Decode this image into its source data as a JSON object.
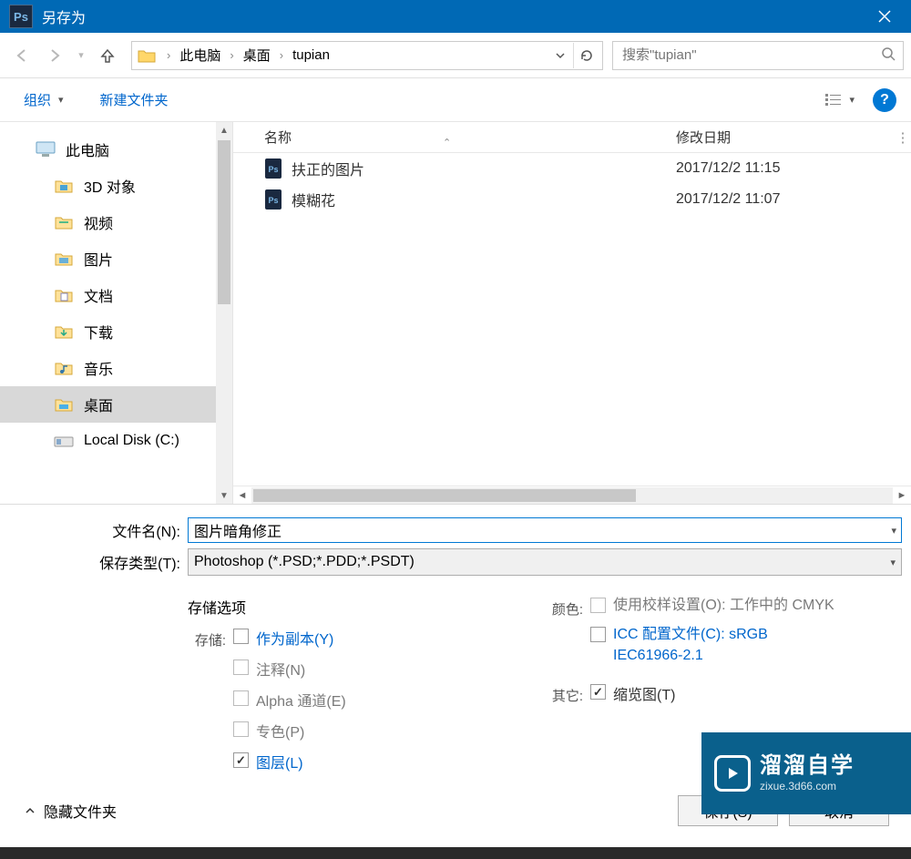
{
  "window": {
    "title": "另存为"
  },
  "breadcrumb": {
    "items": [
      "此电脑",
      "桌面",
      "tupian"
    ]
  },
  "search": {
    "placeholder": "搜索\"tupian\""
  },
  "toolbar": {
    "organize": "组织",
    "newFolder": "新建文件夹"
  },
  "sidebar": {
    "items": [
      {
        "label": "此电脑",
        "indent": false,
        "icon": "pc"
      },
      {
        "label": "3D 对象",
        "indent": true,
        "icon": "3d"
      },
      {
        "label": "视频",
        "indent": true,
        "icon": "video"
      },
      {
        "label": "图片",
        "indent": true,
        "icon": "pics"
      },
      {
        "label": "文档",
        "indent": true,
        "icon": "docs"
      },
      {
        "label": "下载",
        "indent": true,
        "icon": "dl"
      },
      {
        "label": "音乐",
        "indent": true,
        "icon": "music"
      },
      {
        "label": "桌面",
        "indent": true,
        "icon": "desk",
        "selected": true
      },
      {
        "label": "Local Disk (C:)",
        "indent": true,
        "icon": "disk"
      }
    ]
  },
  "filelist": {
    "columns": {
      "name": "名称",
      "modified": "修改日期"
    },
    "rows": [
      {
        "name": "扶正的图片",
        "modified": "2017/12/2 11:15"
      },
      {
        "name": "模糊花",
        "modified": "2017/12/2 11:07"
      }
    ]
  },
  "form": {
    "filenameLabel": "文件名(N):",
    "filenameValue": "图片暗角修正",
    "typeLabel": "保存类型(T):",
    "typeValue": "Photoshop (*.PSD;*.PDD;*.PSDT)"
  },
  "storage": {
    "title": "存储选项",
    "label": "存储:",
    "options": {
      "asCopy": "作为副本(Y)",
      "notes": "注释(N)",
      "alpha": "Alpha 通道(E)",
      "spot": "专色(P)",
      "layers": "图层(L)"
    }
  },
  "color": {
    "label": "颜色:",
    "proof": "使用校样设置(O):  工作中的 CMYK",
    "icc": "ICC 配置文件(C): sRGB IEC61966-2.1"
  },
  "other": {
    "label": "其它:",
    "thumb": "缩览图(T)"
  },
  "footer": {
    "hideFolders": "隐藏文件夹",
    "save": "保存(S)",
    "cancel": "取消"
  },
  "watermark": {
    "big": "溜溜自学",
    "small": "zixue.3d66.com"
  }
}
